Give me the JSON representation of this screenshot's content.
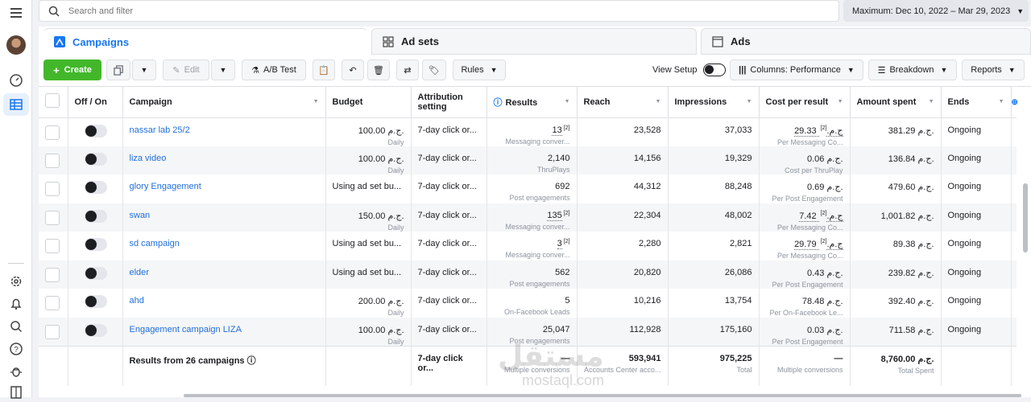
{
  "search": {
    "placeholder": "Search and filter"
  },
  "date_range": "Maximum: Dec 10, 2022 – Mar 29, 2023",
  "tabs": [
    {
      "label": "Campaigns",
      "icon": "campaign-flag-icon"
    },
    {
      "label": "Ad sets",
      "icon": "adsets-grid-icon"
    },
    {
      "label": "Ads",
      "icon": "ad-window-icon"
    }
  ],
  "toolbar": {
    "create": "Create",
    "edit": "Edit",
    "ab_test": "A/B Test",
    "rules": "Rules",
    "view_setup": "View Setup",
    "columns": "Columns: Performance",
    "breakdown": "Breakdown",
    "reports": "Reports"
  },
  "columns": {
    "onoff": "Off / On",
    "campaign": "Campaign",
    "budget": "Budget",
    "attribution": "Attribution setting",
    "results": "Results",
    "reach": "Reach",
    "impressions": "Impressions",
    "cost": "Cost per result",
    "amount": "Amount spent",
    "ends": "Ends"
  },
  "rows": [
    {
      "name": "nassar lab 25/2",
      "budget": "100.00 ج.م.",
      "budget_sub": "Daily",
      "attr": "7-day click or...",
      "results": "13",
      "results_sub": "Messaging conver...",
      "reach": "23,528",
      "impr": "37,033",
      "cost": "29.33 ج.م.",
      "cost_sub": "Per Messaging Co...",
      "amount": "381.29 ج.م.",
      "ends": "Ongoing"
    },
    {
      "name": "liza video",
      "budget": "100.00 ج.م.",
      "budget_sub": "Daily",
      "attr": "7-day click or...",
      "results": "2,140",
      "results_sub": "ThruPlays",
      "reach": "14,156",
      "impr": "19,329",
      "cost": "0.06 ج.م.",
      "cost_sub": "Cost per ThruPlay",
      "amount": "136.84 ج.م.",
      "ends": "Ongoing"
    },
    {
      "name": "glory Engagement",
      "budget": "Using ad set bu...",
      "budget_sub": "",
      "attr": "7-day click or...",
      "results": "692",
      "results_sub": "Post engagements",
      "reach": "44,312",
      "impr": "88,248",
      "cost": "0.69 ج.م.",
      "cost_sub": "Per Post Engagement",
      "amount": "479.60 ج.م.",
      "ends": "Ongoing"
    },
    {
      "name": "swan",
      "budget": "150.00 ج.م.",
      "budget_sub": "Daily",
      "attr": "7-day click or...",
      "results": "135",
      "results_sub": "Messaging conver...",
      "reach": "22,304",
      "impr": "48,002",
      "cost": "7.42 ج.م.",
      "cost_sub": "Per Messaging Co...",
      "amount": "1,001.82 ج.م.",
      "ends": "Ongoing"
    },
    {
      "name": "sd campaign",
      "budget": "Using ad set bu...",
      "budget_sub": "",
      "attr": "7-day click or...",
      "results": "3",
      "results_sub": "Messaging conver...",
      "reach": "2,280",
      "impr": "2,821",
      "cost": "29.79 ج.م.",
      "cost_sub": "Per Messaging Co...",
      "amount": "89.38 ج.م.",
      "ends": "Ongoing"
    },
    {
      "name": "elder",
      "budget": "Using ad set bu...",
      "budget_sub": "",
      "attr": "7-day click or...",
      "results": "562",
      "results_sub": "Post engagements",
      "reach": "20,820",
      "impr": "26,086",
      "cost": "0.43 ج.م.",
      "cost_sub": "Per Post Engagement",
      "amount": "239.82 ج.م.",
      "ends": "Ongoing"
    },
    {
      "name": "ahd",
      "budget": "200.00 ج.م.",
      "budget_sub": "Daily",
      "attr": "7-day click or...",
      "results": "5",
      "results_sub": "On-Facebook Leads",
      "reach": "10,216",
      "impr": "13,754",
      "cost": "78.48 ج.م.",
      "cost_sub": "Per On-Facebook Le...",
      "amount": "392.40 ج.م.",
      "ends": "Ongoing"
    },
    {
      "name": "Engagement campaign LIZA",
      "budget": "100.00 ج.م.",
      "budget_sub": "Daily",
      "attr": "7-day click or...",
      "results": "25,047",
      "results_sub": "Post engagements",
      "reach": "112,928",
      "impr": "175,160",
      "cost": "0.03 ج.م.",
      "cost_sub": "Per Post Engagement",
      "amount": "711.58 ج.م.",
      "ends": "Ongoing"
    }
  ],
  "totals": {
    "label": "Results from 26 campaigns",
    "attr": "7-day click or...",
    "results": "—",
    "results_sub": "Multiple conversions",
    "reach": "593,941",
    "reach_sub": "Accounts Center acco...",
    "impr": "975,225",
    "impr_sub": "Total",
    "cost": "—",
    "cost_sub": "Multiple conversions",
    "amount": "8,760.00 ج.م.",
    "amount_sub": "Total Spent"
  },
  "watermark": {
    "main": "مستقل",
    "sub": "mostaql.com"
  },
  "colors": {
    "accent": "#1877f2",
    "create": "#42b72a",
    "link": "#216fdb"
  }
}
